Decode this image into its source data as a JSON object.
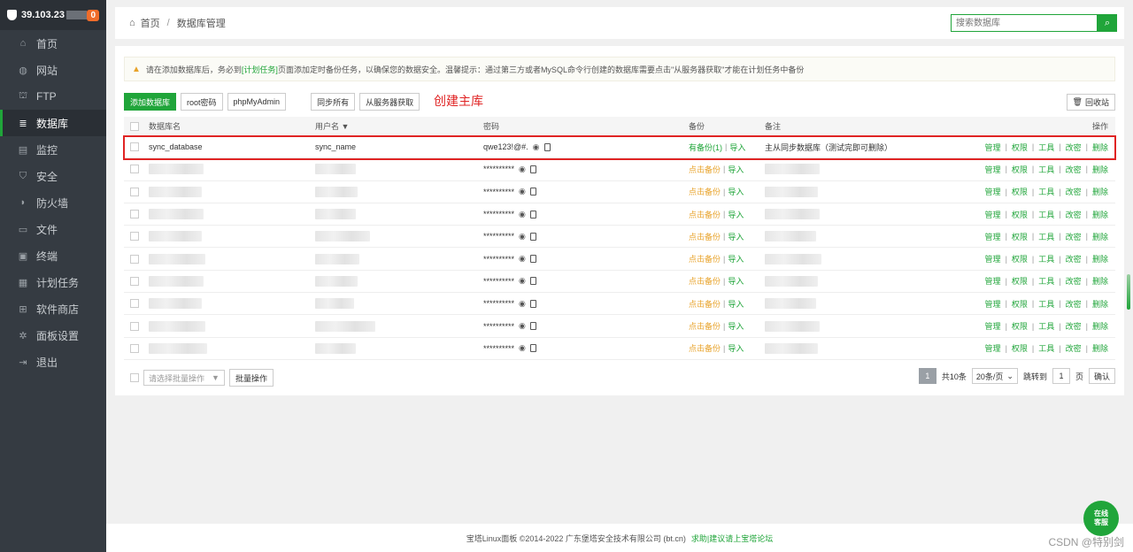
{
  "sidebar": {
    "ip": "39.103.23",
    "badge": "0",
    "items": [
      {
        "label": "首页",
        "icon": "home-icon",
        "glyph": "⌂"
      },
      {
        "label": "网站",
        "icon": "globe-icon",
        "glyph": "◍"
      },
      {
        "label": "FTP",
        "icon": "ftp-icon",
        "glyph": "⛫"
      },
      {
        "label": "数据库",
        "icon": "database-icon",
        "glyph": "≣"
      },
      {
        "label": "监控",
        "icon": "monitor-icon",
        "glyph": "▤"
      },
      {
        "label": "安全",
        "icon": "shield-icon",
        "glyph": "⛉"
      },
      {
        "label": "防火墙",
        "icon": "firewall-icon",
        "glyph": "◗"
      },
      {
        "label": "文件",
        "icon": "folder-icon",
        "glyph": "▭"
      },
      {
        "label": "终端",
        "icon": "terminal-icon",
        "glyph": "▣"
      },
      {
        "label": "计划任务",
        "icon": "calendar-icon",
        "glyph": "▦"
      },
      {
        "label": "软件商店",
        "icon": "apps-icon",
        "glyph": "⊞"
      },
      {
        "label": "面板设置",
        "icon": "settings-icon",
        "glyph": "✲"
      },
      {
        "label": "退出",
        "icon": "logout-icon",
        "glyph": "⇥"
      }
    ]
  },
  "breadcrumb": {
    "home": "首页",
    "current": "数据库管理"
  },
  "search": {
    "placeholder": "搜索数据库"
  },
  "notice": {
    "part1": "请在添加数据库后，务必到",
    "link": "[计划任务]",
    "part2": "页面添加定时备份任务，以确保您的数据安全。温馨提示：通过第三方或者MySQL命令行创建的数据库需要点击\"从服务器获取\"才能在计划任务中备份"
  },
  "toolbar": {
    "add": "添加数据库",
    "root_pwd": "root密码",
    "phpmyadmin": "phpMyAdmin",
    "sync_all": "同步所有",
    "get_from_server": "从服务器获取",
    "recycle": "回收站"
  },
  "annotation": "创建主库",
  "table": {
    "headers": {
      "name": "数据库名",
      "user": "用户名 ▼",
      "password": "密码",
      "backup": "备份",
      "note": "备注",
      "ops": "操作"
    },
    "first_row": {
      "name": "sync_database",
      "user": "sync_name",
      "password": "qwe123!@#.",
      "backup": "有备份(1)",
      "import": "导入",
      "note": "主从同步数据库（测试完即可删除）"
    },
    "masked_password": "**********",
    "backup_none": "点击备份",
    "import": "导入",
    "ops": [
      "管理",
      "权限",
      "工具",
      "改密",
      "删除"
    ]
  },
  "batch": {
    "select": "请选择批量操作",
    "button": "批量操作"
  },
  "pager": {
    "page": "1",
    "total": "共10条",
    "per_page": "20条/页",
    "goto_label": "跳转到",
    "goto_value": "1",
    "page_unit": "页",
    "confirm": "确认"
  },
  "footer": {
    "copyright": "宝塔Linux面板 ©2014-2022 广东堡塔安全技术有限公司 (bt.cn)",
    "link": "求助|建议请上宝塔论坛"
  },
  "chat": {
    "line1": "在线",
    "line2": "客服"
  },
  "watermark": "CSDN @特别剑",
  "colors": {
    "accent": "#20a53a",
    "warning": "#e8a32b",
    "annotation": "#e02424",
    "sidebar": "#353b42"
  }
}
